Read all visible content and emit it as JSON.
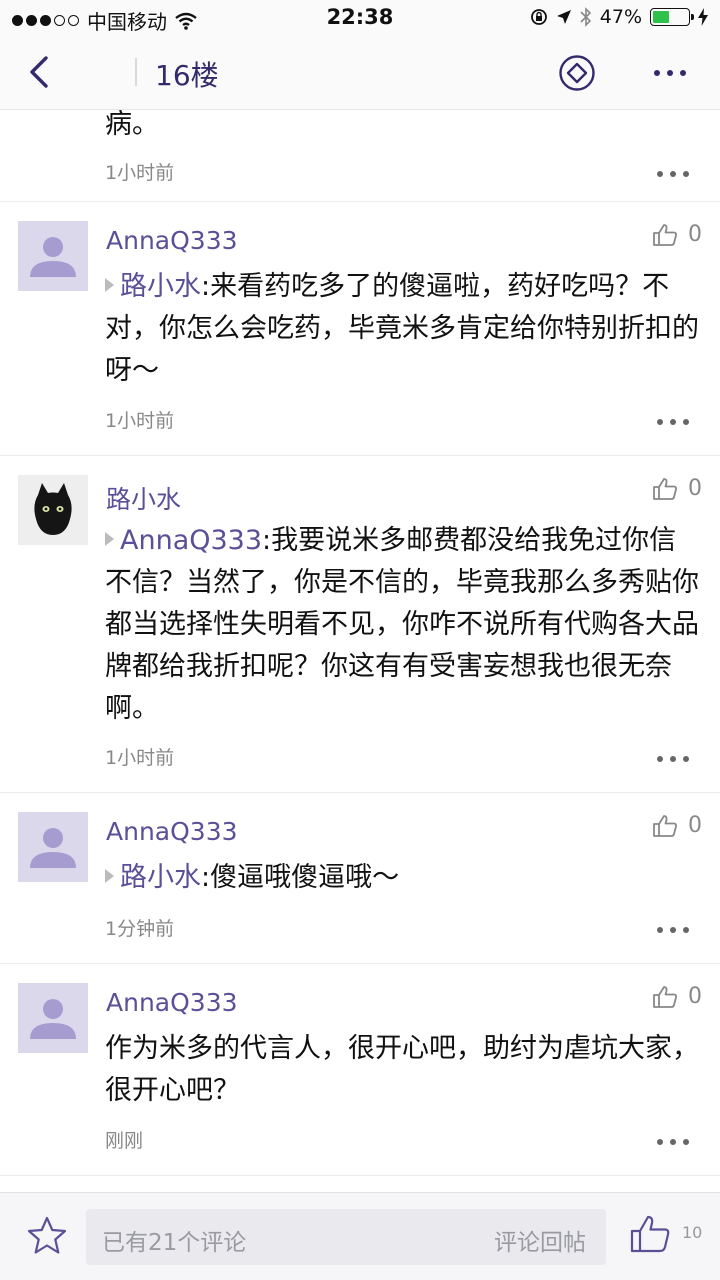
{
  "status_bar": {
    "carrier": "中国移动",
    "time": "22:38",
    "battery": "47%",
    "battery_level": 0.47
  },
  "nav": {
    "title": "16楼"
  },
  "top_fragment": {
    "text": "病。",
    "time": "1小时前"
  },
  "comments": [
    {
      "user": "AnnaQ333",
      "likes": "0",
      "reply_to": "路小水",
      "text": ":来看药吃多了的傻逼啦，药好吃吗？不对，你怎么会吃药，毕竟米多肯定给你特别折扣的呀～",
      "time": "1小时前"
    },
    {
      "user": "路小水",
      "likes": "0",
      "reply_to": "AnnaQ333",
      "text": ":我要说米多邮费都没给我免过你信不信？当然了，你是不信的，毕竟我那么多秀贴你都当选择性失明看不见，你咋不说所有代购各大品牌都给我折扣呢？你这有有受害妄想我也很无奈啊。",
      "time": "1小时前"
    },
    {
      "user": "AnnaQ333",
      "likes": "0",
      "reply_to": "路小水",
      "text": ":傻逼哦傻逼哦～",
      "time": "1分钟前"
    },
    {
      "user": "AnnaQ333",
      "likes": "0",
      "text": "作为米多的代言人，很开心吧，助纣为虐坑大家，很开心吧？",
      "time": "刚刚"
    }
  ],
  "bottom_bar": {
    "placeholder": "已有21个评论",
    "back_label": "评论回帖",
    "like_count": "10"
  },
  "colors": {
    "accent": "#5b4f98",
    "title": "#332a6b",
    "battery_fill": "#2fc24a"
  }
}
